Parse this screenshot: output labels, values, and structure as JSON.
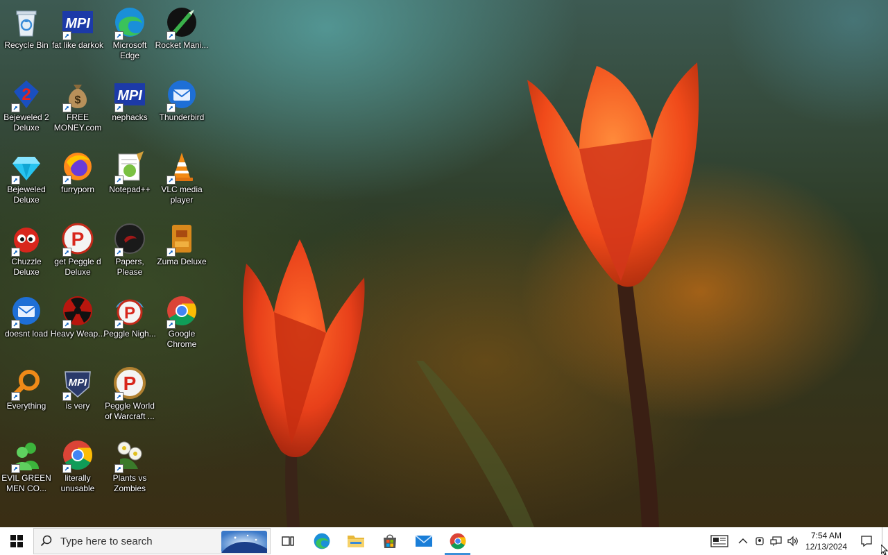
{
  "desktop": {
    "icons": [
      {
        "label": "Recycle Bin",
        "icon": "recycle-bin-icon"
      },
      {
        "label": "fat like darkok",
        "icon": "mpi-logo-icon"
      },
      {
        "label": "Microsoft Edge",
        "icon": "edge-icon"
      },
      {
        "label": "Rocket Mani...",
        "icon": "rocket-mania-icon"
      },
      {
        "label": "Bejeweled 2 Deluxe",
        "icon": "bejeweled-2-icon"
      },
      {
        "label": "FREE MONEY.com",
        "icon": "money-bag-icon"
      },
      {
        "label": "nephacks",
        "icon": "mpi-logo-icon"
      },
      {
        "label": "Thunderbird",
        "icon": "thunderbird-icon"
      },
      {
        "label": "Bejeweled Deluxe",
        "icon": "diamond-icon"
      },
      {
        "label": "furryporn",
        "icon": "firefox-icon"
      },
      {
        "label": "Notepad++",
        "icon": "notepad-plus-plus-icon"
      },
      {
        "label": "VLC media player",
        "icon": "vlc-cone-icon"
      },
      {
        "label": "Chuzzle Deluxe",
        "icon": "chuzzle-icon"
      },
      {
        "label": "get Peggle d Deluxe",
        "icon": "peggle-icon"
      },
      {
        "label": "Papers, Please",
        "icon": "papers-please-icon"
      },
      {
        "label": "Zuma Deluxe",
        "icon": "zuma-icon"
      },
      {
        "label": "doesnt load",
        "icon": "thunderbird-icon"
      },
      {
        "label": "Heavy Weap...",
        "icon": "heavy-weapon-icon"
      },
      {
        "label": "Peggle Nigh...",
        "icon": "peggle-icon"
      },
      {
        "label": "Google Chrome",
        "icon": "chrome-icon"
      },
      {
        "label": "Everything",
        "icon": "everything-search-icon"
      },
      {
        "label": "is very",
        "icon": "mpi-shield-icon"
      },
      {
        "label": "Peggle World of Warcraft ...",
        "icon": "peggle-icon"
      },
      {
        "label": "EVIL GREEN MEN CO...",
        "icon": "green-men-icon"
      },
      {
        "label": "literally unusable",
        "icon": "chrome-icon"
      },
      {
        "label": "Plants vs Zombies",
        "icon": "plants-vs-zombies-icon"
      }
    ]
  },
  "taskbar": {
    "search_placeholder": "Type here to search",
    "pinned": [
      {
        "name": "task-view",
        "icon": "task-view-icon"
      },
      {
        "name": "edge",
        "icon": "edge-icon"
      },
      {
        "name": "file-explorer",
        "icon": "folder-icon"
      },
      {
        "name": "microsoft-store",
        "icon": "store-icon"
      },
      {
        "name": "mail",
        "icon": "mail-icon"
      },
      {
        "name": "chrome",
        "icon": "chrome-icon",
        "active": true
      }
    ],
    "tray": {
      "time": "7:54 AM",
      "date": "12/13/2024"
    }
  },
  "colors": {
    "taskbar_bg": "#ffffff",
    "accent": "#3b8fd8",
    "label_text": "#ffffff"
  }
}
